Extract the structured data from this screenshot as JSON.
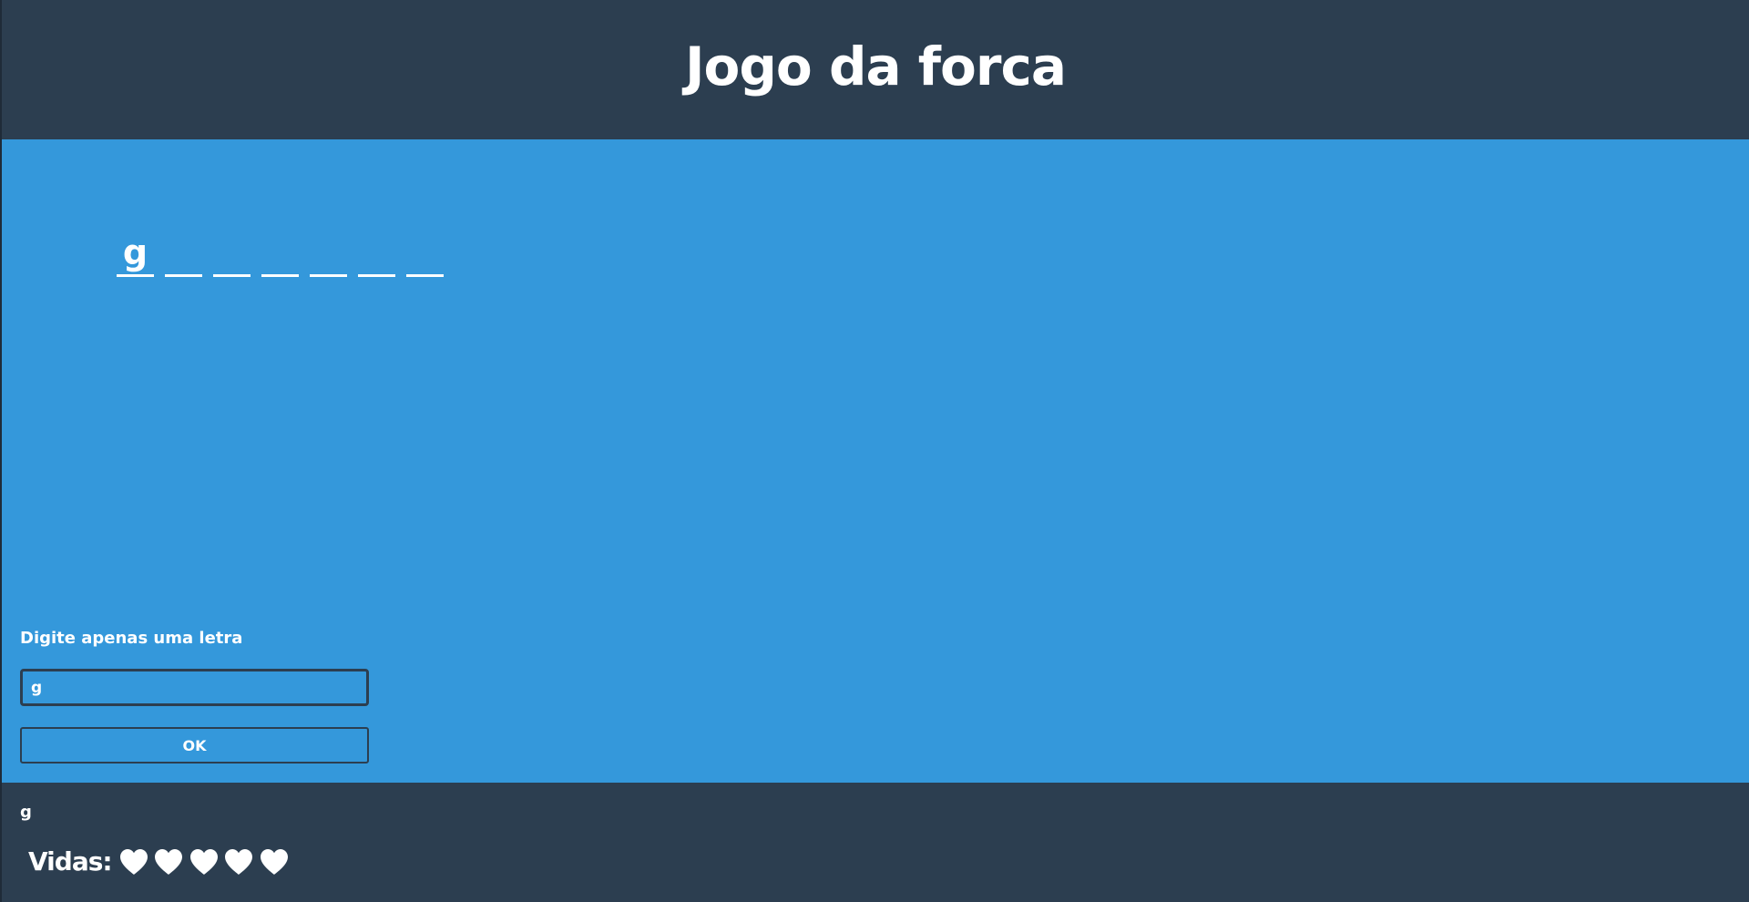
{
  "header": {
    "title": "Jogo da forca"
  },
  "word": {
    "slots": [
      "g",
      "",
      "",
      "",
      "",
      "",
      ""
    ]
  },
  "form": {
    "hint": "Digite apenas uma letra",
    "input_value": "g",
    "button_label": "OK"
  },
  "footer": {
    "guessed_letters": "g",
    "lives_label": "Vidas:",
    "lives": 5,
    "heart_icon": "heart-icon"
  },
  "colors": {
    "header_bg": "#2c3e50",
    "main_bg": "#3498db",
    "text": "#ffffff"
  }
}
